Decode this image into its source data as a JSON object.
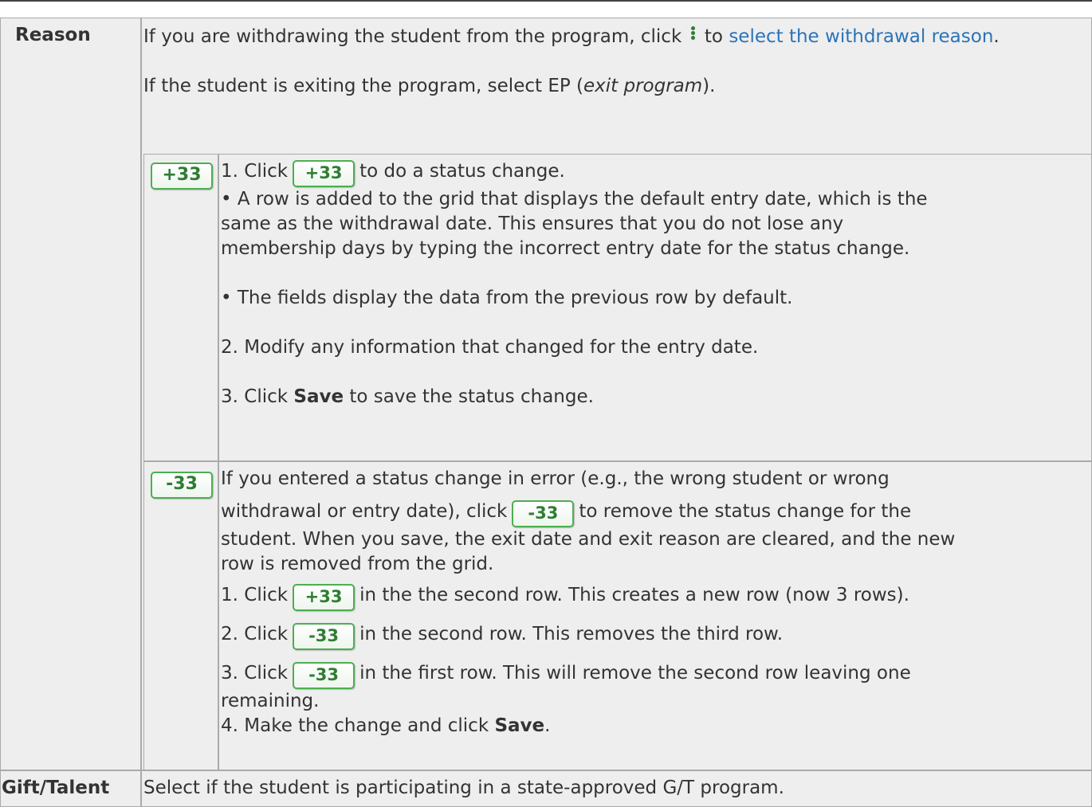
{
  "reason": {
    "label": "Reason",
    "para1_a": "If you are withdrawing the student from the program, click",
    "para1_b": "to",
    "para1_link": "select the withdrawal reason",
    "para1_end": ".",
    "para2_a": "If the student is exiting the program, select EP (",
    "para2_em": "exit program",
    "para2_end": ")."
  },
  "add_row": {
    "icon_label": "+33",
    "l1_a": "1. Click",
    "l1_b": "to do a status change.",
    "l2": "• A row is added to the grid that displays the default entry date, which is the",
    "l3": "same as the withdrawal date. This ensures that you do not lose any",
    "l4": "membership days by typing the incorrect entry date for the status change.",
    "l5": "• The fields display the data from the previous row by default.",
    "l6": "2. Modify any information that changed for the entry date.",
    "l7_a": "3. Click",
    "l7_bold": "Save",
    "l7_b": "to save the status change."
  },
  "remove_row": {
    "icon_label": "-33",
    "l1": "If you entered a status change in error (e.g., the wrong student or wrong",
    "l2_a": "withdrawal or entry date), click",
    "l2_b": "to remove the status change for the",
    "l3": "student. When you save, the exit date and exit reason are cleared, and the new",
    "l4": "row is removed from the grid.",
    "s1_a": "1. Click",
    "s1_b": "in the the second row. This creates a new row (now 3 rows).",
    "s2_a": "2. Click",
    "s2_b": "in the second row. This removes the third row.",
    "s3_a": "3. Click",
    "s3_b": "in the first row. This will remove the second row leaving one",
    "s3_c": "remaining.",
    "s4_a": "4. Make the change and click",
    "s4_bold": "Save",
    "s4_end": "."
  },
  "gift": {
    "label": "Gift/Talent",
    "text": "Select if the student is participating in a state-approved G/T program."
  }
}
